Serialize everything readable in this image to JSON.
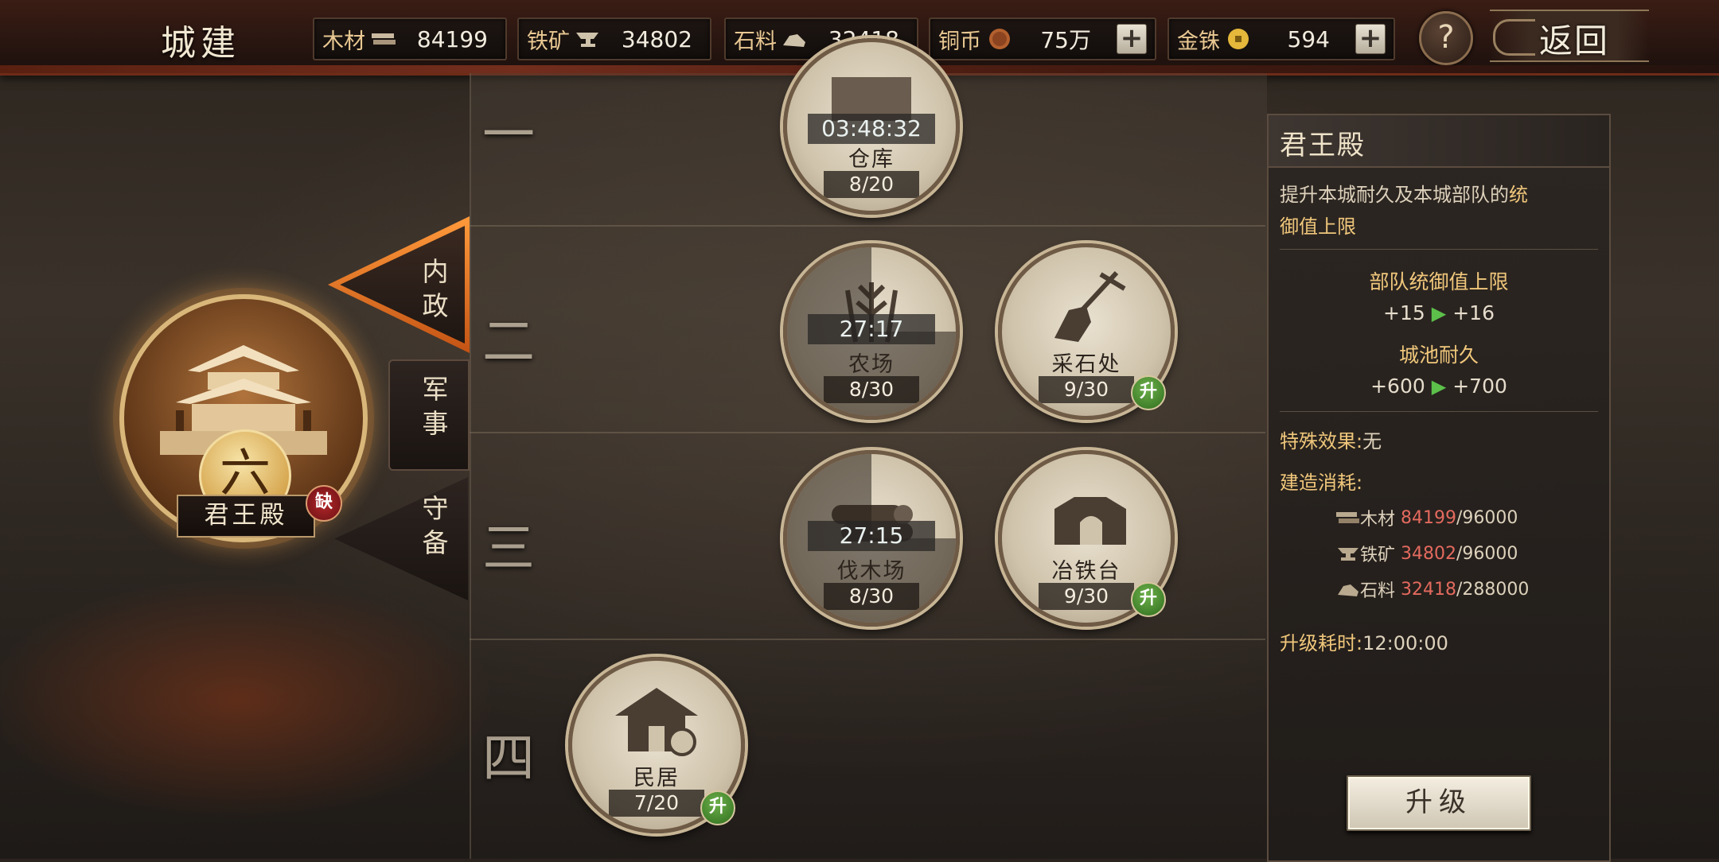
{
  "header": {
    "title": "城建",
    "resources": [
      {
        "label": "木材",
        "icon": "wood-icon",
        "value": "84199"
      },
      {
        "label": "铁矿",
        "icon": "anvil-icon",
        "value": "34802"
      },
      {
        "label": "石料",
        "icon": "stone-icon",
        "value": "32418"
      },
      {
        "label": "铜币",
        "icon": "copper-coin-icon",
        "value": "75万"
      },
      {
        "label": "金铢",
        "icon": "gold-coin-icon",
        "value": "594"
      }
    ],
    "help_label": "?",
    "back_label": "返回"
  },
  "left": {
    "hall_level": "六",
    "hall_name": "君王殿",
    "lack_badge": "缺",
    "tabs": {
      "interior": "内政",
      "military": "军事",
      "defense": "守备"
    }
  },
  "rows": {
    "r1": "一",
    "r2": "二",
    "r3": "三",
    "r4": "四"
  },
  "buildings": {
    "warehouse": {
      "name": "仓库",
      "count": "8/20",
      "timer": "03:48:32"
    },
    "farm": {
      "name": "农场",
      "count": "8/30",
      "timer": "27:17",
      "progress": 0.25
    },
    "quarry": {
      "name": "采石处",
      "count": "9/30",
      "badge": "升"
    },
    "lumber": {
      "name": "伐木场",
      "count": "8/30",
      "timer": "27:15",
      "progress": 0.25
    },
    "smelter": {
      "name": "冶铁台",
      "count": "9/30",
      "badge": "升"
    },
    "residence": {
      "name": "民居",
      "count": "7/20",
      "badge": "升"
    }
  },
  "info": {
    "title": "君王殿",
    "desc_plain": "提升本城耐久及本城部队的",
    "desc_hl_1": "统",
    "desc_hl_2": "御值上限",
    "stat1_name": "部队统御值上限",
    "stat1_from": "+15",
    "stat1_to": "+16",
    "stat2_name": "城池耐久",
    "stat2_from": "+600",
    "stat2_to": "+700",
    "special_label": "特殊效果:",
    "special_value": "无",
    "cost_label": "建造消耗:",
    "costs": [
      {
        "name": "木材",
        "current": "84199",
        "need": "/96000"
      },
      {
        "name": "铁矿",
        "current": "34802",
        "need": "/96000"
      },
      {
        "name": "石料",
        "current": "32418",
        "need": "/288000"
      }
    ],
    "time_label": "升级耗时:",
    "time_value": "12:00:00",
    "upgrade_label": "升级"
  },
  "colors": {
    "accent_gold": "#f0c77b",
    "cost_red": "#e36a5e",
    "upgrade_green": "#4f9b36",
    "tab_active_orange": "#ff9a3b"
  }
}
